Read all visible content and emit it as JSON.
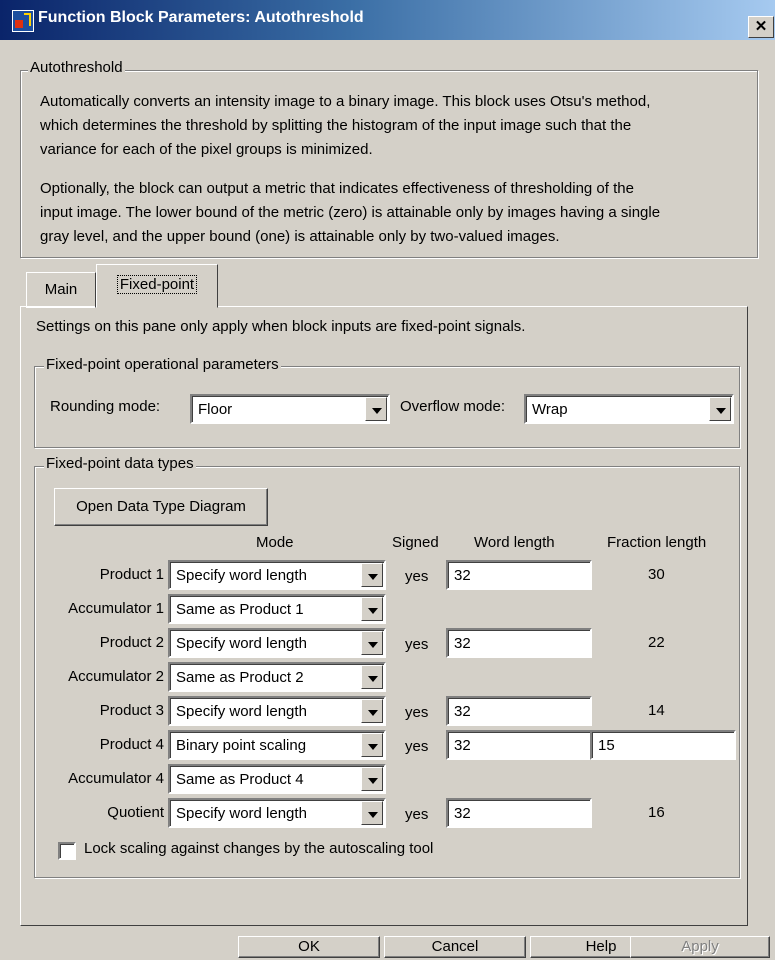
{
  "window": {
    "title": "Function Block Parameters: Autothreshold",
    "close_glyph": "✕"
  },
  "description_group": {
    "legend": "Autothreshold",
    "lines": [
      "Automatically converts an intensity image to a binary image.  This block uses Otsu's method,",
      "which determines the threshold by splitting the histogram of the input image such that the",
      "variance for each of the pixel groups is minimized.",
      "",
      "Optionally, the block can output a metric that indicates effectiveness of thresholding of the",
      "input image.  The lower bound of the metric (zero) is attainable only by images having a single",
      "gray level, and the upper bound (one) is attainable only by two-valued images."
    ]
  },
  "tabs": [
    {
      "label": "Main",
      "active": false
    },
    {
      "label": "Fixed-point",
      "active": true
    }
  ],
  "panel": {
    "note": "Settings on this pane only apply when block inputs are fixed-point signals.",
    "op_params": {
      "legend": "Fixed-point operational parameters",
      "rounding_label": "Rounding mode:",
      "rounding_value": "Floor",
      "overflow_label": "Overflow mode:",
      "overflow_value": "Wrap"
    },
    "data_types": {
      "legend": "Fixed-point data types",
      "open_diagram_button": "Open Data Type Diagram",
      "headers": {
        "mode": "Mode",
        "signed": "Signed",
        "word_length": "Word length",
        "fraction_length": "Fraction length"
      },
      "rows": [
        {
          "label": "Product 1",
          "mode": "Specify word length",
          "signed": "yes",
          "word_length": "32",
          "fraction_length": "30",
          "fraction_editable": false
        },
        {
          "label": "Accumulator 1",
          "mode": "Same as Product 1"
        },
        {
          "label": "Product 2",
          "mode": "Specify word length",
          "signed": "yes",
          "word_length": "32",
          "fraction_length": "22",
          "fraction_editable": false
        },
        {
          "label": "Accumulator 2",
          "mode": "Same as Product 2"
        },
        {
          "label": "Product 3",
          "mode": "Specify word length",
          "signed": "yes",
          "word_length": "32",
          "fraction_length": "14",
          "fraction_editable": false
        },
        {
          "label": "Product 4",
          "mode": "Binary point scaling",
          "signed": "yes",
          "word_length": "32",
          "fraction_length": "15",
          "fraction_editable": true
        },
        {
          "label": "Accumulator 4",
          "mode": "Same as Product 4"
        },
        {
          "label": "Quotient",
          "mode": "Specify word length",
          "signed": "yes",
          "word_length": "32",
          "fraction_length": "16",
          "fraction_editable": false
        }
      ],
      "lock_scaling_label": "Lock scaling against changes by the autoscaling tool",
      "lock_scaling_checked": false
    }
  },
  "buttons": {
    "ok": "OK",
    "cancel": "Cancel",
    "help": "Help",
    "apply": "Apply"
  }
}
